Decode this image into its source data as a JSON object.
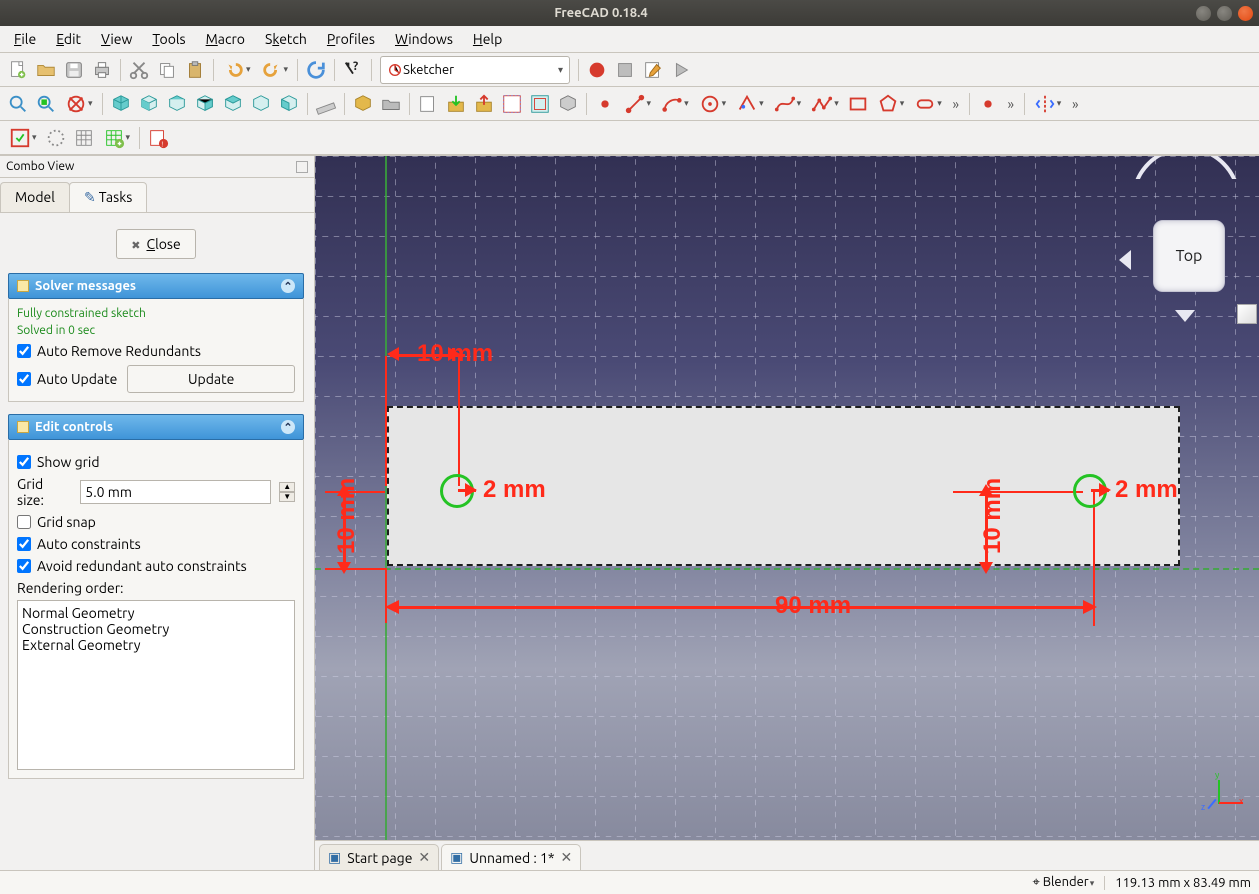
{
  "window": {
    "title": "FreeCAD 0.18.4"
  },
  "menu": [
    "File",
    "Edit",
    "View",
    "Tools",
    "Macro",
    "Sketch",
    "Profiles",
    "Windows",
    "Help"
  ],
  "workbench": {
    "selected": "Sketcher"
  },
  "combo_view": {
    "title": "Combo View",
    "tabs": {
      "model": "Model",
      "tasks": "Tasks"
    },
    "close_label": "Close"
  },
  "solver": {
    "heading": "Solver messages",
    "msg1": "Fully constrained sketch",
    "msg2": "Solved in 0 sec",
    "auto_remove": "Auto Remove Redundants",
    "auto_update": "Auto Update",
    "update_btn": "Update"
  },
  "edit_controls": {
    "heading": "Edit controls",
    "show_grid": "Show grid",
    "grid_size_label": "Grid size:",
    "grid_size_value": "5.0 mm",
    "grid_snap": "Grid snap",
    "auto_constraints": "Auto constraints",
    "avoid_redundant": "Avoid redundant auto constraints",
    "rendering_order_label": "Rendering order:",
    "rendering_order": [
      "Normal Geometry",
      "Construction Geometry",
      "External Geometry"
    ]
  },
  "dimensions": {
    "top": "10 mm",
    "left": "10 mm",
    "r1": "2 mm",
    "r2": "2 mm",
    "v1": "10 mm",
    "bottom": "90 mm"
  },
  "navcube": {
    "face": "Top"
  },
  "doc_tabs": {
    "start": "Start page",
    "unnamed": "Unnamed : 1*"
  },
  "status": {
    "nav_style": "Blender",
    "dims": "119.13 mm x 83.49 mm"
  }
}
